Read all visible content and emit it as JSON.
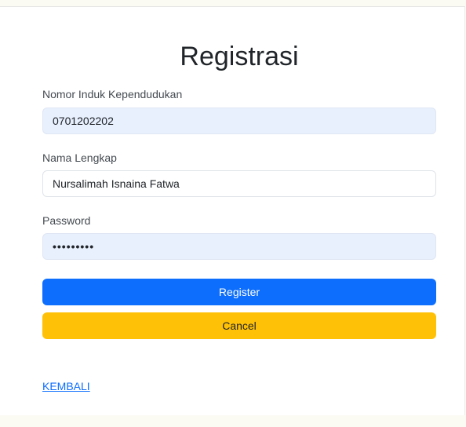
{
  "form": {
    "title": "Registrasi",
    "nik": {
      "label": "Nomor Induk Kependudukan",
      "value": "0701202202"
    },
    "nama": {
      "label": "Nama Lengkap",
      "value": "Nursalimah Isnaina Fatwa"
    },
    "password": {
      "label": "Password",
      "value": "•••••••••"
    },
    "register_label": "Register",
    "cancel_label": "Cancel",
    "back_link": "KEMBALI"
  },
  "colors": {
    "primary": "#0d6efd",
    "warning": "#ffc107",
    "autofill": "#e8f0fe"
  }
}
